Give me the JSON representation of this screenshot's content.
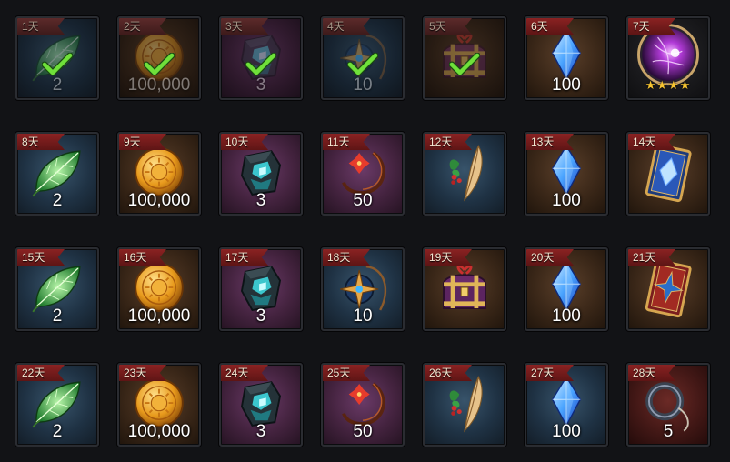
{
  "rewards": [
    {
      "day": "1天",
      "qty": "2",
      "icon": "green-leaf-icon",
      "claimed": true,
      "bg": "blue"
    },
    {
      "day": "2天",
      "qty": "100,000",
      "icon": "gold-coin-icon",
      "claimed": true,
      "bg": "brown"
    },
    {
      "day": "3天",
      "qty": "3",
      "icon": "teal-crystal-stone-icon",
      "claimed": true,
      "bg": "purple"
    },
    {
      "day": "4天",
      "qty": "10",
      "icon": "star-compass-amulet-icon",
      "claimed": true,
      "bg": "blue"
    },
    {
      "day": "5天",
      "qty": "",
      "icon": "treasure-chest-icon",
      "claimed": true,
      "bg": "brown"
    },
    {
      "day": "6天",
      "qty": "100",
      "icon": "blue-crystal-icon",
      "claimed": false,
      "bg": "brown"
    },
    {
      "day": "7天",
      "qty": "",
      "icon": "purple-orb-portrait-icon",
      "claimed": false,
      "bg": "dark",
      "stars": "★★★★"
    },
    {
      "day": "8天",
      "qty": "2",
      "icon": "green-leaf-icon",
      "claimed": false,
      "bg": "blue"
    },
    {
      "day": "9天",
      "qty": "100,000",
      "icon": "gold-coin-icon",
      "claimed": false,
      "bg": "brown"
    },
    {
      "day": "10天",
      "qty": "3",
      "icon": "teal-crystal-stone-icon",
      "claimed": false,
      "bg": "purple"
    },
    {
      "day": "11天",
      "qty": "50",
      "icon": "red-flower-whip-icon",
      "claimed": false,
      "bg": "purple"
    },
    {
      "day": "12天",
      "qty": "",
      "icon": "feather-herb-icon",
      "claimed": false,
      "bg": "blue"
    },
    {
      "day": "13天",
      "qty": "100",
      "icon": "blue-crystal-icon",
      "claimed": false,
      "bg": "brown"
    },
    {
      "day": "14天",
      "qty": "",
      "icon": "blue-gem-card-icon",
      "claimed": false,
      "bg": "brown"
    },
    {
      "day": "15天",
      "qty": "2",
      "icon": "green-leaf-icon",
      "claimed": false,
      "bg": "blue"
    },
    {
      "day": "16天",
      "qty": "100,000",
      "icon": "gold-coin-icon",
      "claimed": false,
      "bg": "brown"
    },
    {
      "day": "17天",
      "qty": "3",
      "icon": "teal-crystal-stone-icon",
      "claimed": false,
      "bg": "purple"
    },
    {
      "day": "18天",
      "qty": "10",
      "icon": "star-compass-amulet-icon",
      "claimed": false,
      "bg": "blue"
    },
    {
      "day": "19天",
      "qty": "",
      "icon": "treasure-chest-icon",
      "claimed": false,
      "bg": "brown"
    },
    {
      "day": "20天",
      "qty": "100",
      "icon": "blue-crystal-icon",
      "claimed": false,
      "bg": "brown"
    },
    {
      "day": "21天",
      "qty": "",
      "icon": "red-gold-card-icon",
      "claimed": false,
      "bg": "brown"
    },
    {
      "day": "22天",
      "qty": "2",
      "icon": "green-leaf-icon",
      "claimed": false,
      "bg": "blue"
    },
    {
      "day": "23天",
      "qty": "100,000",
      "icon": "gold-coin-icon",
      "claimed": false,
      "bg": "brown"
    },
    {
      "day": "24天",
      "qty": "3",
      "icon": "teal-crystal-stone-icon",
      "claimed": false,
      "bg": "purple"
    },
    {
      "day": "25天",
      "qty": "50",
      "icon": "red-flower-whip-icon",
      "claimed": false,
      "bg": "purple"
    },
    {
      "day": "26天",
      "qty": "",
      "icon": "feather-herb-icon",
      "claimed": false,
      "bg": "blue"
    },
    {
      "day": "27天",
      "qty": "100",
      "icon": "blue-crystal-icon",
      "claimed": false,
      "bg": "blue"
    },
    {
      "day": "28天",
      "qty": "5",
      "icon": "rope-ring-icon",
      "claimed": false,
      "bg": "red"
    }
  ]
}
